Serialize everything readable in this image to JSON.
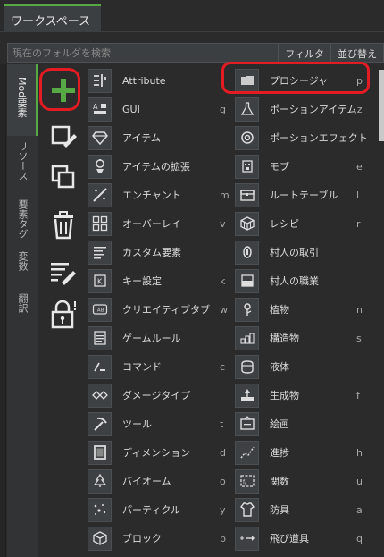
{
  "window": {
    "tab_label": "ワークスペース"
  },
  "search": {
    "placeholder": "現在のフォルダを検索",
    "filter_label": "フィルタ",
    "sort_label": "並び替え"
  },
  "vertical_tabs": [
    {
      "label": "Mod要素",
      "active": true
    },
    {
      "label": "リソース",
      "active": false
    },
    {
      "label": "要素タグ",
      "active": false
    },
    {
      "label": "変数",
      "active": false
    },
    {
      "label": "翻訳",
      "active": false
    }
  ],
  "actions": [
    "add",
    "edit",
    "duplicate",
    "delete",
    "rename",
    "lock"
  ],
  "colors": {
    "accent_green": "#56a944",
    "highlight_red": "#e31b23",
    "background": "#2b2b2b"
  },
  "left_column": [
    {
      "label": "Attribute",
      "shortcut": "",
      "icon": "attribute-icon"
    },
    {
      "label": "GUI",
      "shortcut": "g",
      "icon": "gui-icon"
    },
    {
      "label": "アイテム",
      "shortcut": "i",
      "icon": "gem-icon"
    },
    {
      "label": "アイテムの拡張",
      "shortcut": "",
      "icon": "item-extension-icon"
    },
    {
      "label": "エンチャント",
      "shortcut": "m",
      "icon": "enchant-icon"
    },
    {
      "label": "オーバーレイ",
      "shortcut": "v",
      "icon": "overlay-icon"
    },
    {
      "label": "カスタム要素",
      "shortcut": "",
      "icon": "custom-element-icon"
    },
    {
      "label": "キー設定",
      "shortcut": "k",
      "icon": "keybind-icon"
    },
    {
      "label": "クリエイティブタブ",
      "shortcut": "w",
      "icon": "creative-tab-icon"
    },
    {
      "label": "ゲームルール",
      "shortcut": "",
      "icon": "gamerule-icon"
    },
    {
      "label": "コマンド",
      "shortcut": "c",
      "icon": "command-icon"
    },
    {
      "label": "ダメージタイプ",
      "shortcut": "",
      "icon": "damage-type-icon"
    },
    {
      "label": "ツール",
      "shortcut": "t",
      "icon": "pickaxe-icon"
    },
    {
      "label": "ディメンション",
      "shortcut": "d",
      "icon": "dimension-icon"
    },
    {
      "label": "バイオーム",
      "shortcut": "o",
      "icon": "biome-icon"
    },
    {
      "label": "パーティクル",
      "shortcut": "y",
      "icon": "particle-icon"
    },
    {
      "label": "ブロック",
      "shortcut": "b",
      "icon": "block-icon"
    }
  ],
  "right_column": [
    {
      "label": "プロシージャ",
      "shortcut": "p",
      "icon": "procedure-icon"
    },
    {
      "label": "ポーションアイテム",
      "shortcut": "z",
      "icon": "flask-icon"
    },
    {
      "label": "ポーションエフェクト",
      "shortcut": "",
      "icon": "potion-effect-icon"
    },
    {
      "label": "モブ",
      "shortcut": "e",
      "icon": "mob-icon"
    },
    {
      "label": "ルートテーブル",
      "shortcut": "l",
      "icon": "loot-table-icon"
    },
    {
      "label": "レシピ",
      "shortcut": "r",
      "icon": "recipe-icon"
    },
    {
      "label": "村人の取引",
      "shortcut": "",
      "icon": "villager-trade-icon"
    },
    {
      "label": "村人の職業",
      "shortcut": "",
      "icon": "villager-profession-icon"
    },
    {
      "label": "植物",
      "shortcut": "n",
      "icon": "plant-icon"
    },
    {
      "label": "構造物",
      "shortcut": "s",
      "icon": "structure-icon"
    },
    {
      "label": "液体",
      "shortcut": "",
      "icon": "fluid-icon"
    },
    {
      "label": "生成物",
      "shortcut": "f",
      "icon": "feature-icon"
    },
    {
      "label": "絵画",
      "shortcut": "",
      "icon": "painting-icon"
    },
    {
      "label": "進捗",
      "shortcut": "h",
      "icon": "advancement-icon"
    },
    {
      "label": "関数",
      "shortcut": "u",
      "icon": "function-icon"
    },
    {
      "label": "防具",
      "shortcut": "a",
      "icon": "armor-icon"
    },
    {
      "label": "飛び道具",
      "shortcut": "q",
      "icon": "projectile-icon"
    }
  ]
}
